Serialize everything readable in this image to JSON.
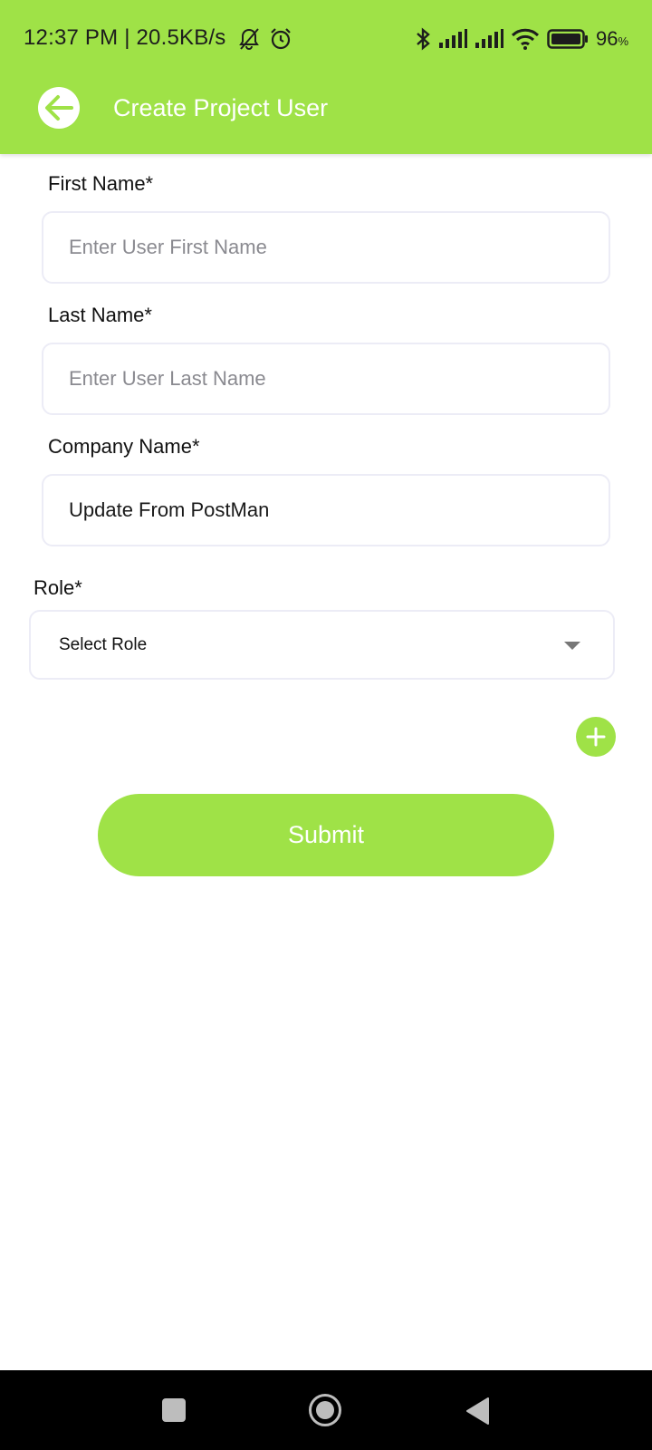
{
  "status_bar": {
    "time": "12:37 PM | 20.5KB/s",
    "battery_pct": "96",
    "battery_unit": "%",
    "icons_left": [
      "mute-notification-icon",
      "alarm-icon"
    ],
    "icons_right": [
      "bluetooth-icon",
      "signal-icon",
      "signal-icon",
      "wifi-icon",
      "battery-icon"
    ]
  },
  "header": {
    "title": "Create Project User",
    "back_icon": "back-arrow-icon"
  },
  "form": {
    "first_name": {
      "label": "First Name*",
      "placeholder": "Enter User First Name",
      "value": ""
    },
    "last_name": {
      "label": "Last Name*",
      "placeholder": "Enter User Last Name",
      "value": ""
    },
    "company_name": {
      "label": "Company Name*",
      "placeholder": "",
      "value": "Update From PostMan"
    },
    "role": {
      "label": "Role*",
      "selected": "Select Role"
    },
    "add_icon": "plus-icon",
    "submit_label": "Submit"
  },
  "navbar": {
    "icons": [
      "recent-apps-icon",
      "home-icon",
      "back-icon"
    ]
  },
  "colors": {
    "accent": "#9fe247",
    "field_border": "#ececf6",
    "navbar": "#000000"
  }
}
